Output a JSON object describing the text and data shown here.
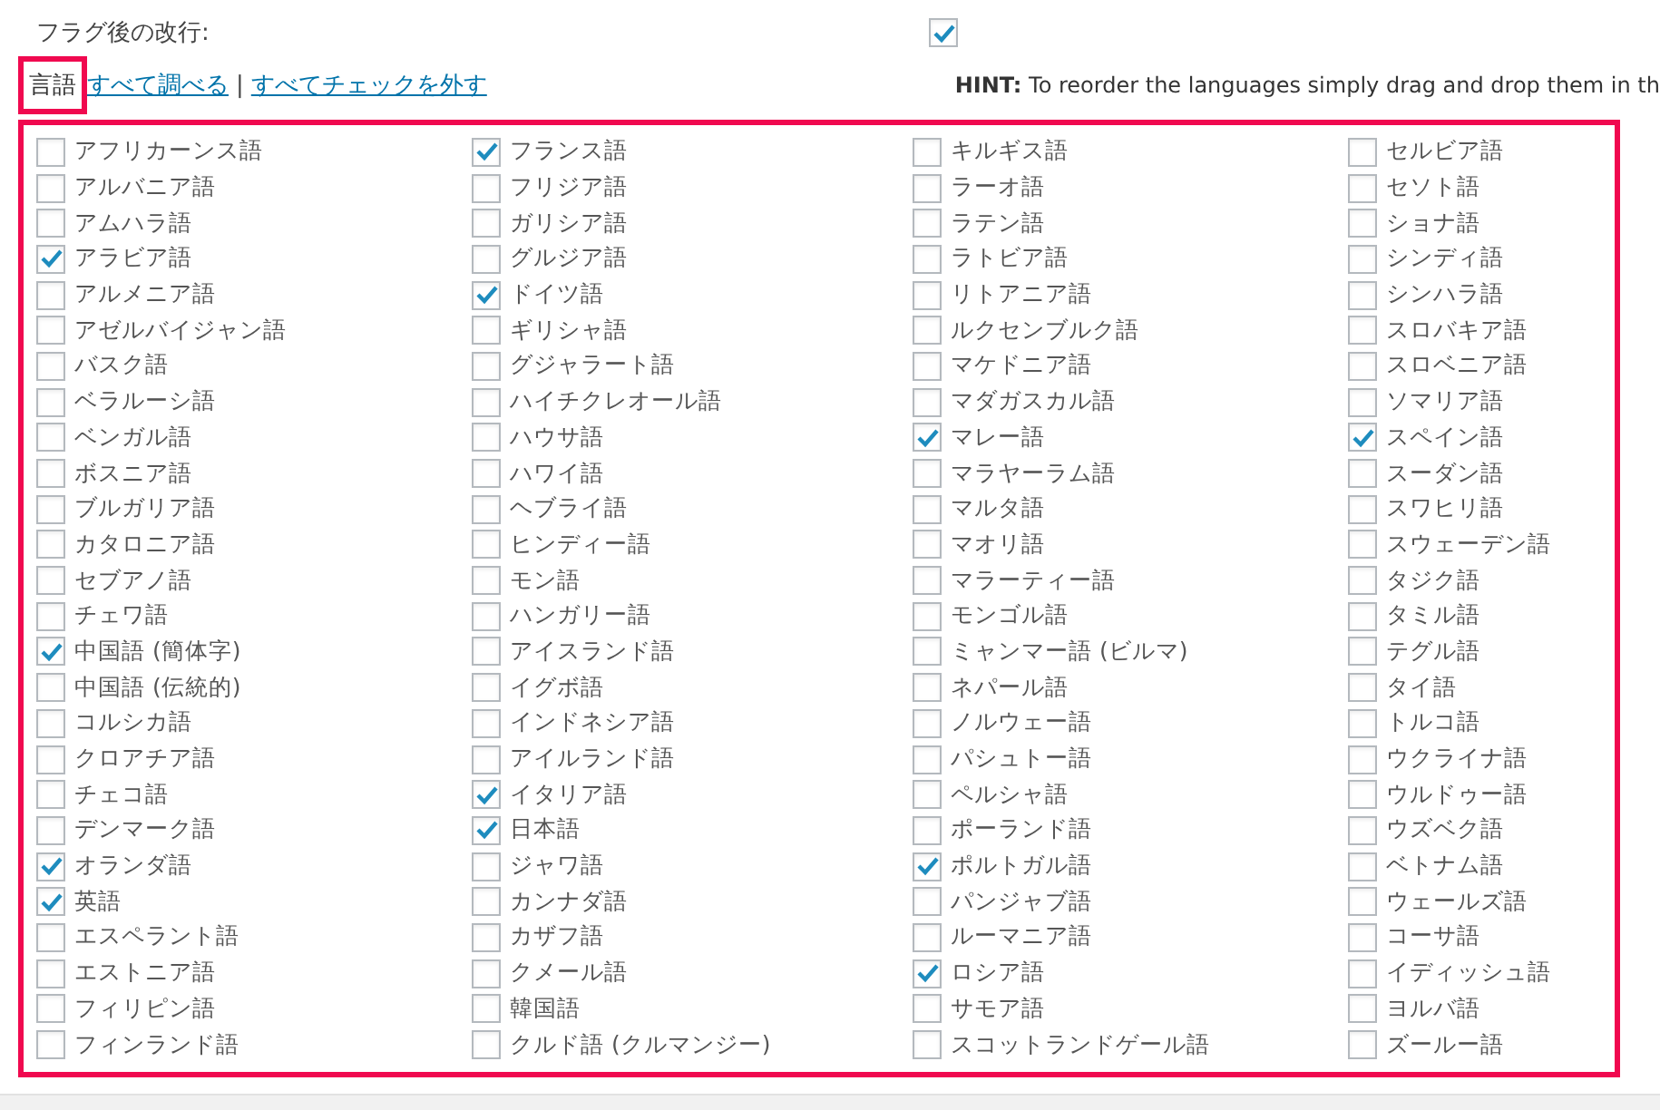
{
  "flag_line_break": {
    "label": "フラグ後の改行:",
    "checked": true
  },
  "languages_header": {
    "label": "言語",
    "highlighted": true,
    "links": [
      "すべて調べる",
      "すべてチェックを外す"
    ],
    "separator": "|",
    "hint_label": "HINT:",
    "hint": "To reorder the languages simply drag and drop them in th"
  },
  "language_columns": [
    [
      {
        "label": "アフリカーンス語",
        "checked": false
      },
      {
        "label": "アルバニア語",
        "checked": false
      },
      {
        "label": "アムハラ語",
        "checked": false
      },
      {
        "label": "アラビア語",
        "checked": true
      },
      {
        "label": "アルメニア語",
        "checked": false
      },
      {
        "label": "アゼルバイジャン語",
        "checked": false
      },
      {
        "label": "バスク語",
        "checked": false
      },
      {
        "label": "ベラルーシ語",
        "checked": false
      },
      {
        "label": "ベンガル語",
        "checked": false
      },
      {
        "label": "ボスニア語",
        "checked": false
      },
      {
        "label": "ブルガリア語",
        "checked": false
      },
      {
        "label": "カタロニア語",
        "checked": false
      },
      {
        "label": "セブアノ語",
        "checked": false
      },
      {
        "label": "チェワ語",
        "checked": false
      },
      {
        "label": "中国語 (簡体字)",
        "checked": true
      },
      {
        "label": "中国語 (伝統的)",
        "checked": false
      },
      {
        "label": "コルシカ語",
        "checked": false
      },
      {
        "label": "クロアチア語",
        "checked": false
      },
      {
        "label": "チェコ語",
        "checked": false
      },
      {
        "label": "デンマーク語",
        "checked": false
      },
      {
        "label": "オランダ語",
        "checked": true
      },
      {
        "label": "英語",
        "checked": true
      },
      {
        "label": "エスペラント語",
        "checked": false
      },
      {
        "label": "エストニア語",
        "checked": false
      },
      {
        "label": "フィリピン語",
        "checked": false
      },
      {
        "label": "フィンランド語",
        "checked": false
      }
    ],
    [
      {
        "label": "フランス語",
        "checked": true
      },
      {
        "label": "フリジア語",
        "checked": false
      },
      {
        "label": "ガリシア語",
        "checked": false
      },
      {
        "label": "グルジア語",
        "checked": false
      },
      {
        "label": "ドイツ語",
        "checked": true
      },
      {
        "label": "ギリシャ語",
        "checked": false
      },
      {
        "label": "グジャラート語",
        "checked": false
      },
      {
        "label": "ハイチクレオール語",
        "checked": false
      },
      {
        "label": "ハウサ語",
        "checked": false
      },
      {
        "label": "ハワイ語",
        "checked": false
      },
      {
        "label": "ヘブライ語",
        "checked": false
      },
      {
        "label": "ヒンディー語",
        "checked": false
      },
      {
        "label": "モン語",
        "checked": false
      },
      {
        "label": "ハンガリー語",
        "checked": false
      },
      {
        "label": "アイスランド語",
        "checked": false
      },
      {
        "label": "イグボ語",
        "checked": false
      },
      {
        "label": "インドネシア語",
        "checked": false
      },
      {
        "label": "アイルランド語",
        "checked": false
      },
      {
        "label": "イタリア語",
        "checked": true
      },
      {
        "label": "日本語",
        "checked": true
      },
      {
        "label": "ジャワ語",
        "checked": false
      },
      {
        "label": "カンナダ語",
        "checked": false
      },
      {
        "label": "カザフ語",
        "checked": false
      },
      {
        "label": "クメール語",
        "checked": false
      },
      {
        "label": "韓国語",
        "checked": false
      },
      {
        "label": "クルド語 (クルマンジー)",
        "checked": false
      }
    ],
    [
      {
        "label": "キルギス語",
        "checked": false
      },
      {
        "label": "ラーオ語",
        "checked": false
      },
      {
        "label": "ラテン語",
        "checked": false
      },
      {
        "label": "ラトビア語",
        "checked": false
      },
      {
        "label": "リトアニア語",
        "checked": false
      },
      {
        "label": "ルクセンブルク語",
        "checked": false
      },
      {
        "label": "マケドニア語",
        "checked": false
      },
      {
        "label": "マダガスカル語",
        "checked": false
      },
      {
        "label": "マレー語",
        "checked": true
      },
      {
        "label": "マラヤーラム語",
        "checked": false
      },
      {
        "label": "マルタ語",
        "checked": false
      },
      {
        "label": "マオリ語",
        "checked": false
      },
      {
        "label": "マラーティー語",
        "checked": false
      },
      {
        "label": "モンゴル語",
        "checked": false
      },
      {
        "label": "ミャンマー語 (ビルマ)",
        "checked": false
      },
      {
        "label": "ネパール語",
        "checked": false
      },
      {
        "label": "ノルウェー語",
        "checked": false
      },
      {
        "label": "パシュトー語",
        "checked": false
      },
      {
        "label": "ペルシャ語",
        "checked": false
      },
      {
        "label": "ポーランド語",
        "checked": false
      },
      {
        "label": "ポルトガル語",
        "checked": true
      },
      {
        "label": "パンジャブ語",
        "checked": false
      },
      {
        "label": "ルーマニア語",
        "checked": false
      },
      {
        "label": "ロシア語",
        "checked": true
      },
      {
        "label": "サモア語",
        "checked": false
      },
      {
        "label": "スコットランドゲール語",
        "checked": false
      }
    ],
    [
      {
        "label": "セルビア語",
        "checked": false
      },
      {
        "label": "セソト語",
        "checked": false
      },
      {
        "label": "ショナ語",
        "checked": false
      },
      {
        "label": "シンディ語",
        "checked": false
      },
      {
        "label": "シンハラ語",
        "checked": false
      },
      {
        "label": "スロバキア語",
        "checked": false
      },
      {
        "label": "スロベニア語",
        "checked": false
      },
      {
        "label": "ソマリア語",
        "checked": false
      },
      {
        "label": "スペイン語",
        "checked": true
      },
      {
        "label": "スーダン語",
        "checked": false
      },
      {
        "label": "スワヒリ語",
        "checked": false
      },
      {
        "label": "スウェーデン語",
        "checked": false
      },
      {
        "label": "タジク語",
        "checked": false
      },
      {
        "label": "タミル語",
        "checked": false
      },
      {
        "label": "テグル語",
        "checked": false
      },
      {
        "label": "タイ語",
        "checked": false
      },
      {
        "label": "トルコ語",
        "checked": false
      },
      {
        "label": "ウクライナ語",
        "checked": false
      },
      {
        "label": "ウルドゥー語",
        "checked": false
      },
      {
        "label": "ウズベク語",
        "checked": false
      },
      {
        "label": "ベトナム語",
        "checked": false
      },
      {
        "label": "ウェールズ語",
        "checked": false
      },
      {
        "label": "コーサ語",
        "checked": false
      },
      {
        "label": "イディッシュ語",
        "checked": false
      },
      {
        "label": "ヨルバ語",
        "checked": false
      },
      {
        "label": "ズールー語",
        "checked": false
      }
    ]
  ]
}
